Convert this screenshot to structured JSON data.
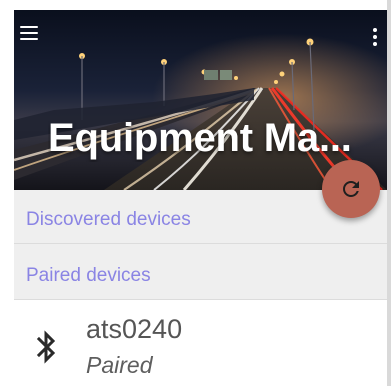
{
  "app": {
    "title": "Equipment Ma..."
  },
  "toolbar": {
    "menu_icon": "hamburger-menu-icon",
    "more_icon": "more-vertical-icon"
  },
  "fab": {
    "icon": "refresh-icon",
    "color": "#b96454"
  },
  "sections": [
    {
      "label": "Discovered devices"
    },
    {
      "label": "Paired devices"
    }
  ],
  "devices": [
    {
      "name": "ats0240",
      "status": "Paired",
      "icon": "bluetooth-icon"
    }
  ],
  "colors": {
    "section_label": "#8a84e4",
    "section_bg": "#efefef",
    "text_primary": "#555555"
  }
}
